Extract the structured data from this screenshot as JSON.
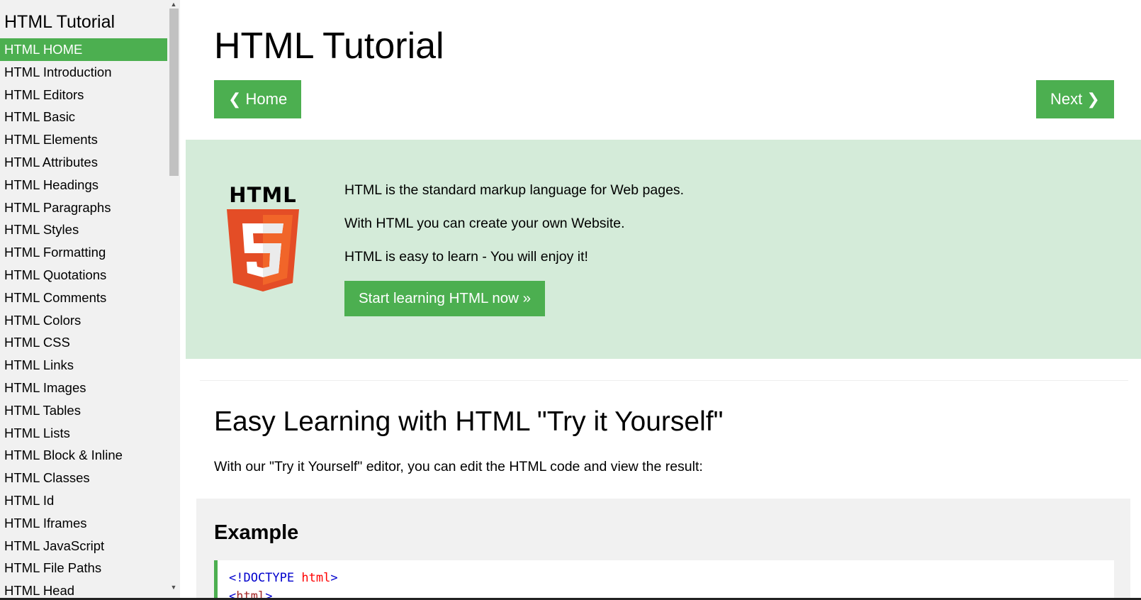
{
  "sidebar": {
    "title": "HTML Tutorial",
    "items": [
      {
        "label": "HTML HOME",
        "active": true
      },
      {
        "label": "HTML Introduction"
      },
      {
        "label": "HTML Editors"
      },
      {
        "label": "HTML Basic"
      },
      {
        "label": "HTML Elements"
      },
      {
        "label": "HTML Attributes"
      },
      {
        "label": "HTML Headings"
      },
      {
        "label": "HTML Paragraphs"
      },
      {
        "label": "HTML Styles"
      },
      {
        "label": "HTML Formatting"
      },
      {
        "label": "HTML Quotations"
      },
      {
        "label": "HTML Comments"
      },
      {
        "label": "HTML Colors"
      },
      {
        "label": "HTML CSS"
      },
      {
        "label": "HTML Links"
      },
      {
        "label": "HTML Images"
      },
      {
        "label": "HTML Tables"
      },
      {
        "label": "HTML Lists"
      },
      {
        "label": "HTML Block & Inline"
      },
      {
        "label": "HTML Classes"
      },
      {
        "label": "HTML Id"
      },
      {
        "label": "HTML Iframes"
      },
      {
        "label": "HTML JavaScript"
      },
      {
        "label": "HTML File Paths"
      },
      {
        "label": "HTML Head"
      }
    ]
  },
  "main": {
    "title": "HTML Tutorial",
    "home_button": "❮ Home",
    "next_button": "Next ❯",
    "hero": {
      "logo_text": "HTML",
      "logo_digit": "5",
      "paragraphs": [
        "HTML is the standard markup language for Web pages.",
        "With HTML you can create your own Website.",
        "HTML is easy to learn - You will enjoy it!"
      ],
      "cta": "Start learning HTML now »"
    },
    "section_title": "Easy Learning with HTML \"Try it Yourself\"",
    "section_intro": "With our \"Try it Yourself\" editor, you can edit the HTML code and view the result:",
    "example": {
      "title": "Example",
      "doctype_open": "<!DOCTYPE",
      "doctype_attr": "html",
      "doctype_close": ">",
      "html_open": "<",
      "html_tag": "html",
      "html_close": ">"
    }
  },
  "colors": {
    "accent": "#4caf50",
    "hero_bg": "#d4ebd9",
    "sidebar_bg": "#f1f1f1",
    "html5_orange": "#f16529",
    "html5_dark_orange": "#e44d26"
  },
  "icons": {
    "logo": "html5-shield-icon",
    "prev": "chevron-left-icon",
    "next": "chevron-right-icon",
    "scroll_up": "triangle-up-icon",
    "scroll_down": "triangle-down-icon"
  }
}
